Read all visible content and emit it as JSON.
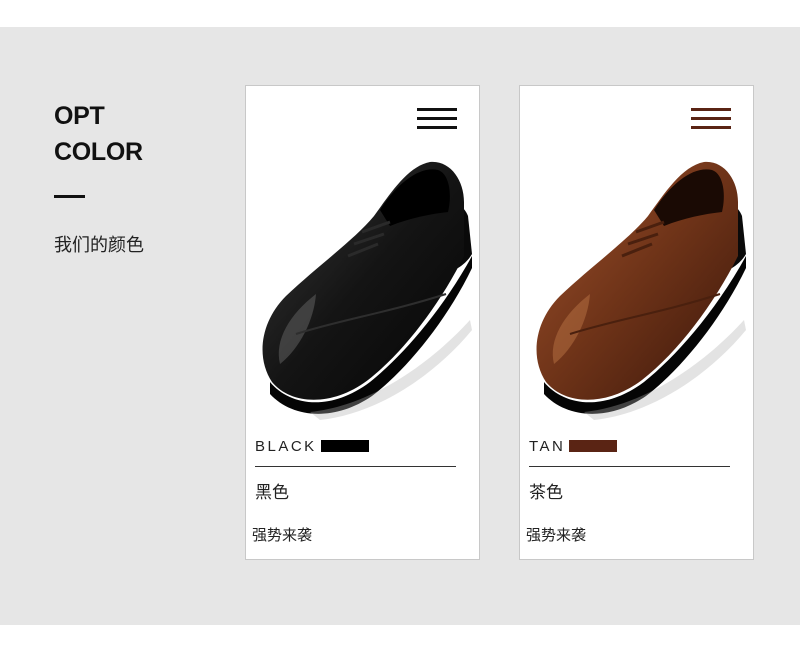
{
  "heading": {
    "line1": "OPT",
    "line2": "COLOR"
  },
  "subtitle": "我们的颜色",
  "cards": [
    {
      "color_name": "BLACK",
      "color_cn": "黑色",
      "slogan": "强势来袭",
      "swatch_color": "#000000",
      "menu_icon_color": "#111111",
      "shoe_color": "#141414"
    },
    {
      "color_name": "TAN",
      "color_cn": "茶色",
      "slogan": "强势来袭",
      "swatch_color": "#5a2414",
      "menu_icon_color": "#5a2414",
      "shoe_color": "#7a3a1c"
    }
  ],
  "colors": {
    "background": "#e6e6e6",
    "card": "#ffffff"
  }
}
